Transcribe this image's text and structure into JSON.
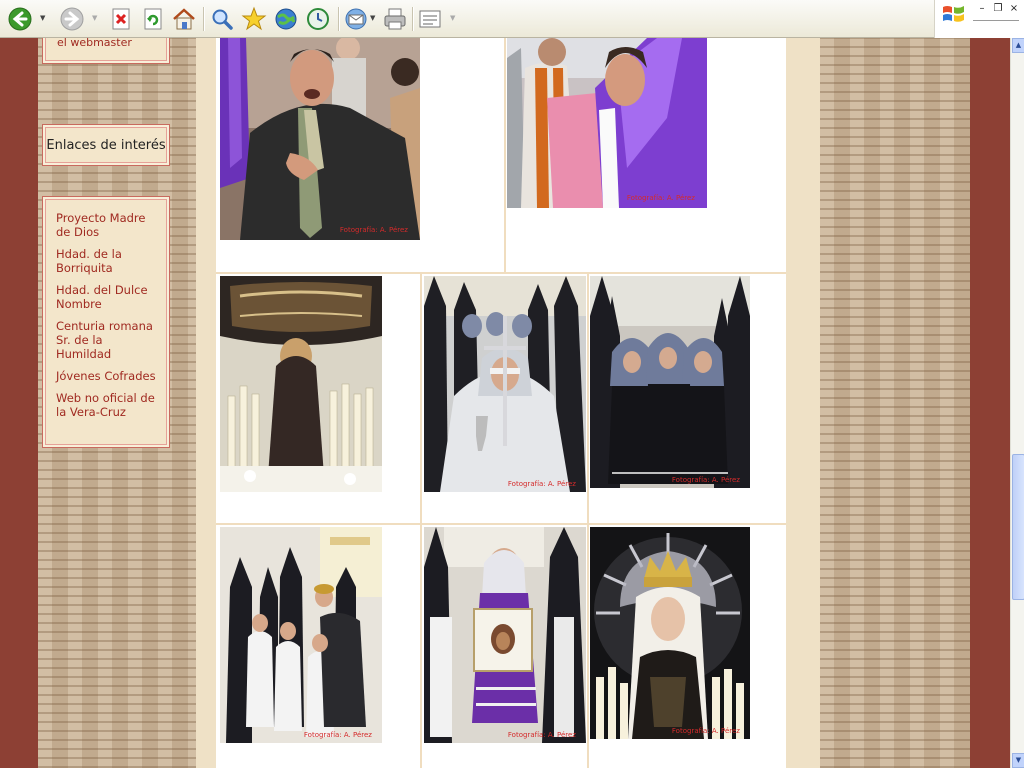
{
  "toolbar": {
    "buttons": [
      "back-icon",
      "forward-icon",
      "stop-icon",
      "refresh-icon",
      "home-icon",
      "search-icon",
      "favorites-icon",
      "media-icon",
      "history-icon",
      "mail-icon",
      "print-icon",
      "edit-icon"
    ],
    "window_controls": {
      "minimize": "–",
      "restore": "❐",
      "close": "×"
    }
  },
  "sidebar": {
    "webmaster_label": "el webmaster",
    "enlaces_title": "Enlaces de interés",
    "links": [
      {
        "label": "Proyecto Madre de Dios"
      },
      {
        "label": "Hdad. de la Borriquita"
      },
      {
        "label": "Hdad. del Dulce Nombre"
      },
      {
        "label": "Centuria romana Sr. de la Humildad"
      },
      {
        "label": "Jóvenes Cofrades"
      },
      {
        "label": "Web no oficial de la Vera-Cruz"
      }
    ]
  },
  "gallery": {
    "credit": "Fotografía: A. Pérez",
    "photos": [
      {
        "subject": "man-singing-saeta"
      },
      {
        "subject": "woman-in-purple-singing"
      },
      {
        "subject": "paso-with-candles"
      },
      {
        "subject": "girl-with-chalice"
      },
      {
        "subject": "hooded-penitents"
      },
      {
        "subject": "children-nazarenos"
      },
      {
        "subject": "girl-with-veronica-banner"
      },
      {
        "subject": "virgin-with-crown"
      }
    ]
  },
  "colors": {
    "link": "#a02a21",
    "border_red": "#8d4034",
    "cream": "#efe1c6",
    "purple": "#7b3ec4",
    "credit_red": "#d42b2b"
  }
}
